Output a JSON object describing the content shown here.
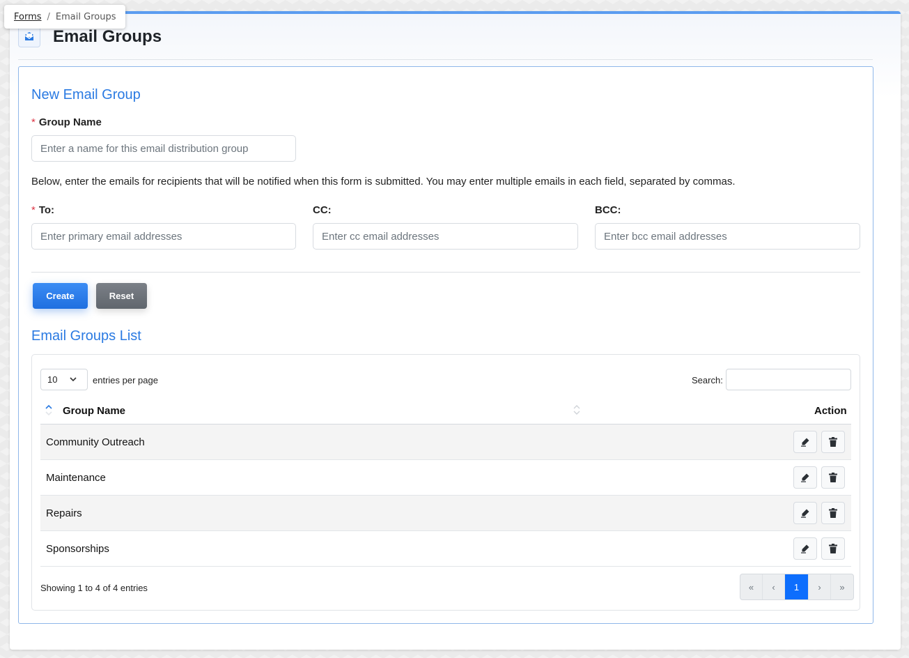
{
  "breadcrumb": {
    "parent": "Forms",
    "separator": "/",
    "current": "Email Groups"
  },
  "page": {
    "title": "Email Groups",
    "icon": "envelope-open-icon"
  },
  "form": {
    "section_title": "New Email Group",
    "required_marker": "*",
    "group_name": {
      "label": "Group Name",
      "placeholder": "Enter a name for this email distribution group",
      "value": ""
    },
    "help_text": "Below, enter the emails for recipients that will be notified when this form is submitted. You may enter multiple emails in each field, separated by commas.",
    "to": {
      "label": "To:",
      "placeholder": "Enter primary email addresses",
      "value": ""
    },
    "cc": {
      "label": "CC:",
      "placeholder": "Enter cc email addresses",
      "value": ""
    },
    "bcc": {
      "label": "BCC:",
      "placeholder": "Enter bcc email addresses",
      "value": ""
    },
    "create_label": "Create",
    "reset_label": "Reset"
  },
  "list": {
    "section_title": "Email Groups List",
    "page_length": "10",
    "entries_label": "entries per page",
    "search_label": "Search:",
    "search_value": "",
    "columns": {
      "group_name": "Group Name",
      "action": "Action"
    },
    "rows": [
      {
        "name": "Community Outreach"
      },
      {
        "name": "Maintenance"
      },
      {
        "name": "Repairs"
      },
      {
        "name": "Sponsorships"
      }
    ],
    "info": "Showing 1 to 4 of 4 entries",
    "pagination": {
      "first": "«",
      "prev": "‹",
      "current": "1",
      "next": "›",
      "last": "»"
    }
  },
  "colors": {
    "accent": "#2a7ae2",
    "primary_button": "#1f6fe0",
    "secondary_button": "#6c737a",
    "required": "#dc3545",
    "active_page": "#0d6efd"
  }
}
